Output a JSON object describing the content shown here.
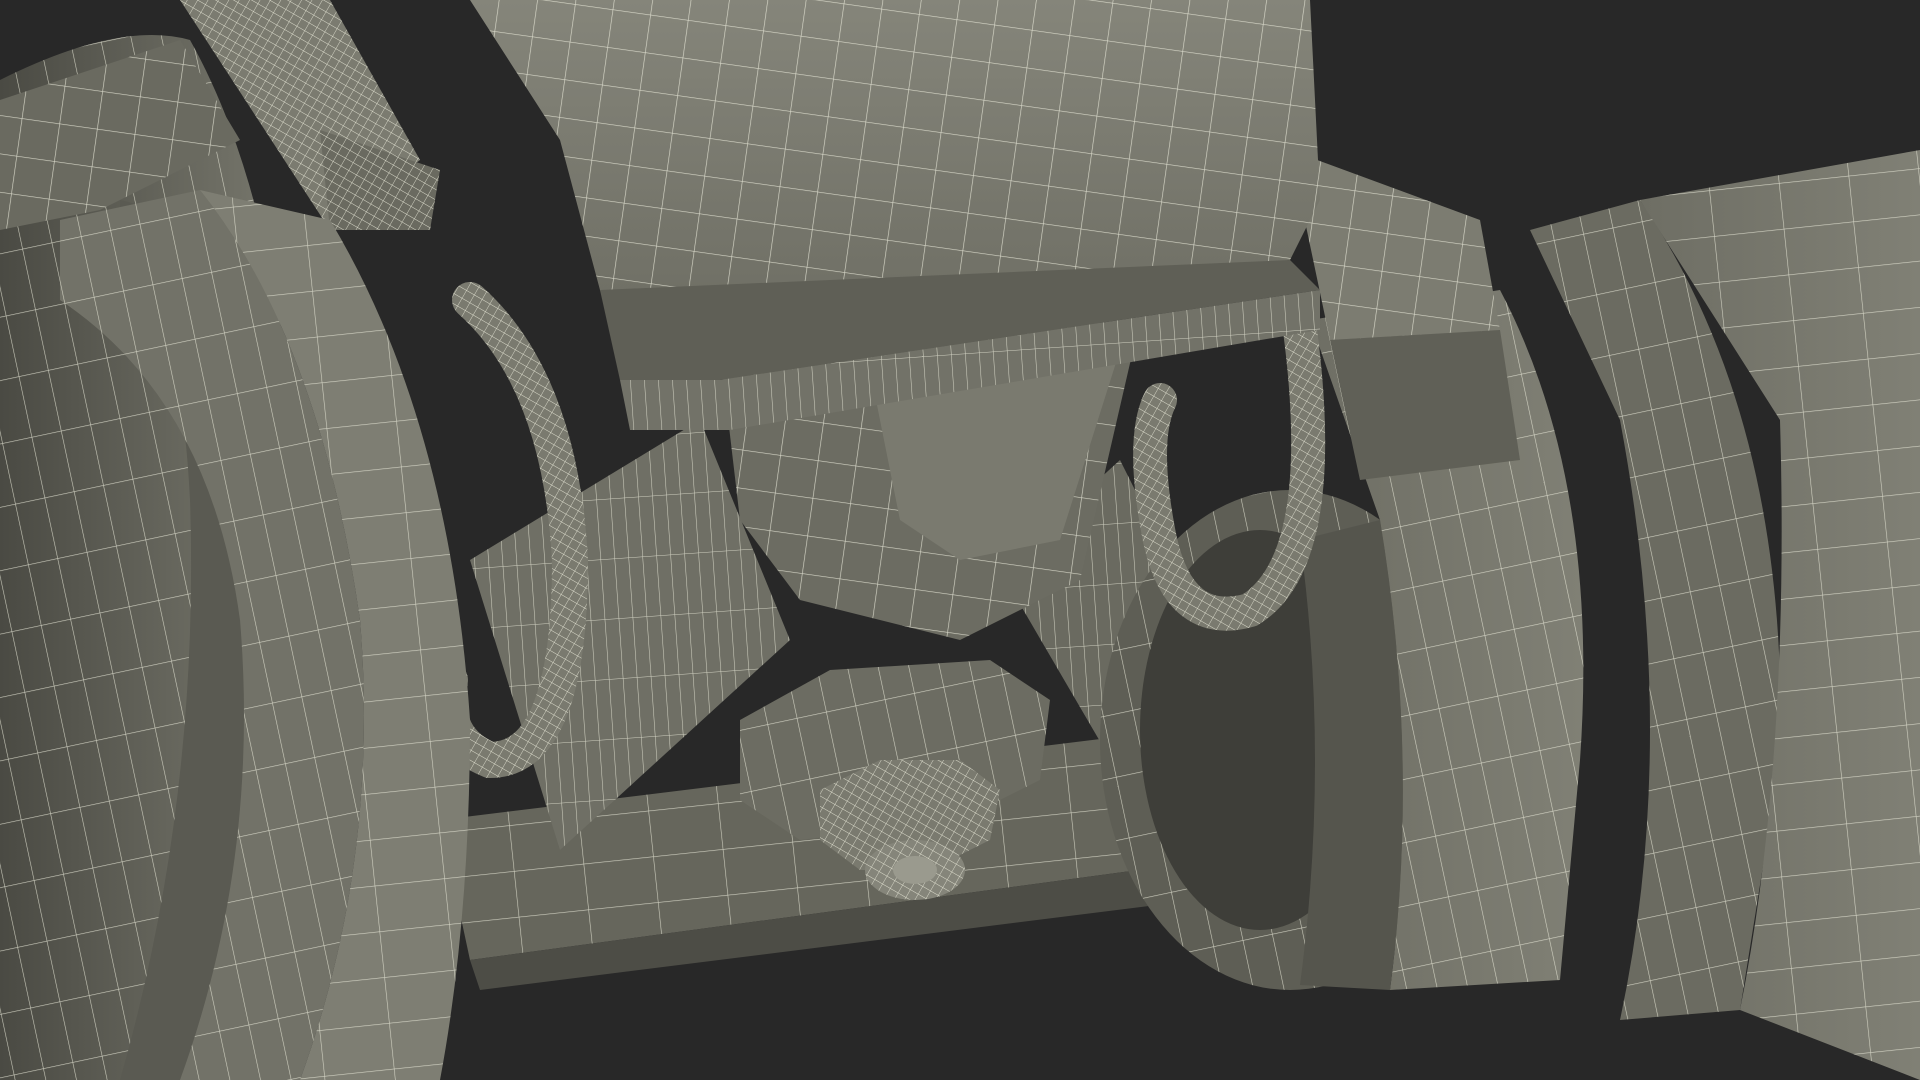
{
  "scene": {
    "description_label": "",
    "colors": {
      "background": "#282828",
      "surface_light": "#8a8a7e",
      "surface_mid": "#77776c",
      "surface_dark": "#5c5c53",
      "surface_shadow": "#45453f",
      "wire": "#e8e8d8"
    },
    "render_mode": "wireframe-on-shaded"
  }
}
